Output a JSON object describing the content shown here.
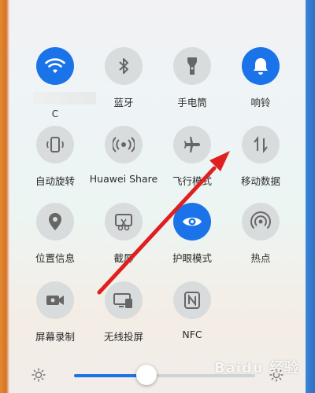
{
  "tiles": [
    {
      "label": "",
      "sub": "C",
      "icon": "wifi-icon",
      "on": true
    },
    {
      "label": "蓝牙",
      "icon": "bluetooth-icon",
      "on": false
    },
    {
      "label": "手电筒",
      "icon": "flashlight-icon",
      "on": false
    },
    {
      "label": "响铃",
      "icon": "bell-icon",
      "on": true
    },
    {
      "label": "自动旋转",
      "icon": "auto-rotate-icon",
      "on": false
    },
    {
      "label": "Huawei Share",
      "icon": "huawei-share-icon",
      "on": false
    },
    {
      "label": "飞行模式",
      "icon": "airplane-icon",
      "on": false
    },
    {
      "label": "移动数据",
      "icon": "mobile-data-icon",
      "on": false
    },
    {
      "label": "位置信息",
      "icon": "location-icon",
      "on": false
    },
    {
      "label": "截屏",
      "icon": "screenshot-icon",
      "on": false
    },
    {
      "label": "护眼模式",
      "icon": "eye-icon",
      "on": true
    },
    {
      "label": "热点",
      "icon": "hotspot-icon",
      "on": false
    },
    {
      "label": "屏幕录制",
      "icon": "screen-record-icon",
      "on": false
    },
    {
      "label": "无线投屏",
      "icon": "wireless-projection-icon",
      "on": false
    },
    {
      "label": "NFC",
      "icon": "nfc-icon",
      "on": false
    }
  ],
  "brightness": {
    "level": 0.4
  },
  "watermark": "Baidu 经验",
  "colors": {
    "active": "#1a73e8",
    "inactive": "#d9dcdc",
    "arrow": "#e02020"
  }
}
